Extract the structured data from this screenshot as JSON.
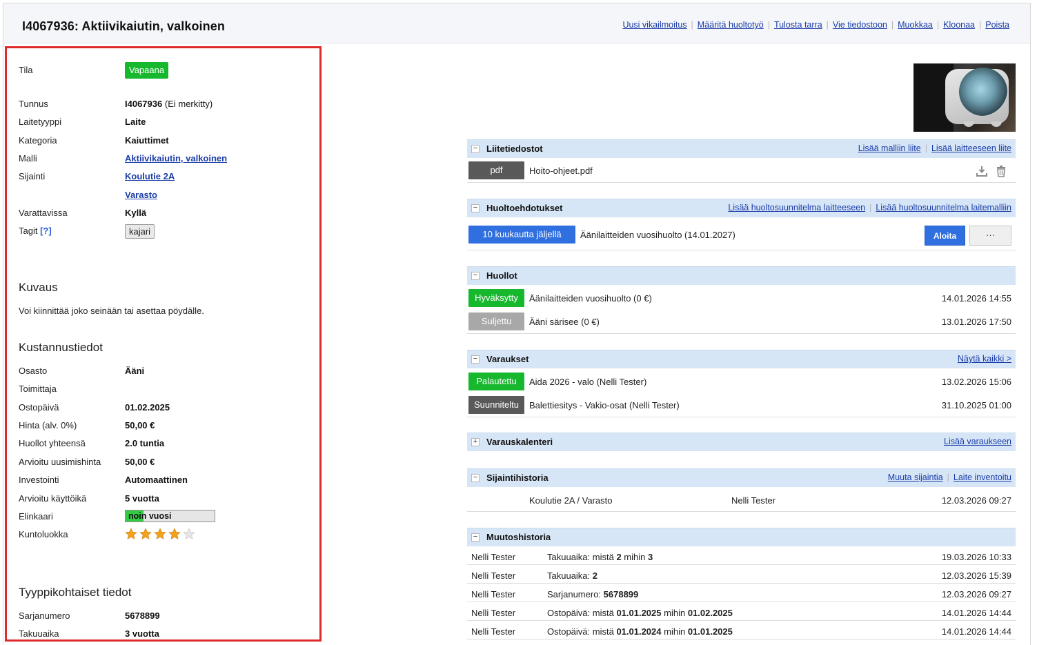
{
  "header": {
    "title": "I4067936: Aktiivikaiutin, valkoinen",
    "actions": [
      "Uusi vikailmoitus",
      "Määritä huoltotyö",
      "Tulosta tarra",
      "Vie tiedostoon",
      "Muokkaa",
      "Kloonaa",
      "Poista"
    ]
  },
  "details": {
    "tila_label": "Tila",
    "tila_value": "Vapaana",
    "tunnus_label": "Tunnus",
    "tunnus_value": "I4067936",
    "tunnus_note": "(Ei merkitty)",
    "laitetyyppi_label": "Laitetyyppi",
    "laitetyyppi_value": "Laite",
    "kategoria_label": "Kategoria",
    "kategoria_value": "Kaiuttimet",
    "malli_label": "Malli",
    "malli_value": "Aktiivikaiutin, valkoinen",
    "sijainti_label": "Sijainti",
    "sijainti_value1": "Koulutie 2A",
    "sijainti_value2": "Varasto",
    "varattavissa_label": "Varattavissa",
    "varattavissa_value": "Kyllä",
    "tagit_label": "Tagit",
    "tagit_help": "[?]",
    "tag": "kajari"
  },
  "kuvaus": {
    "heading": "Kuvaus",
    "text": "Voi kiinnittää joko seinään tai asettaa pöydälle."
  },
  "kustannus": {
    "heading": "Kustannustiedot",
    "rows": [
      {
        "label": "Osasto",
        "value": "Ääni"
      },
      {
        "label": "Toimittaja",
        "value": ""
      },
      {
        "label": "Ostopäivä",
        "value": "01.02.2025"
      },
      {
        "label": "Hinta (alv. 0%)",
        "value": "50,00 €"
      },
      {
        "label": "Huollot yhteensä",
        "value": "2.0 tuntia"
      },
      {
        "label": "Arvioitu uusimishinta",
        "value": "50,00 €"
      },
      {
        "label": "Investointi",
        "value": "Automaattinen"
      },
      {
        "label": "Arvioitu käyttöikä",
        "value": "5 vuotta"
      }
    ],
    "elinkaari_label": "Elinkaari",
    "elinkaari_value": "noin vuosi",
    "elinkaari_fraction": 0.2,
    "kuntoluokka_label": "Kuntoluokka",
    "kuntoluokka_rating": 4,
    "kuntoluokka_max": 5
  },
  "tyyppi": {
    "heading": "Tyyppikohtaiset tiedot",
    "rows": [
      {
        "label": "Sarjanumero",
        "value": "5678899"
      },
      {
        "label": "Takuuaika",
        "value": "3 vuotta"
      }
    ]
  },
  "liitetiedostot": {
    "title": "Liitetiedostot",
    "links": [
      "Lisää malliin liite",
      "Lisää laitteeseen liite"
    ],
    "file_type": "pdf",
    "file_name": "Hoito-ohjeet.pdf"
  },
  "huoltoehdotukset": {
    "title": "Huoltoehdotukset",
    "links": [
      "Lisää huoltosuunnitelma laitteeseen",
      "Lisää huoltosuunnitelma laitemalliin"
    ],
    "status": "10 kuukautta jäljellä",
    "name": "Äänilaitteiden vuosihuolto (14.01.2027)",
    "start_button": "Aloita",
    "more_button": "···"
  },
  "huollot": {
    "title": "Huollot",
    "rows": [
      {
        "status": "Hyväksytty",
        "name": "Äänilaitteiden vuosihuolto (0 €)",
        "date": "14.01.2026 14:55"
      },
      {
        "status": "Suljettu",
        "name": "Ääni särisee (0 €)",
        "date": "13.01.2026 17:50"
      }
    ]
  },
  "varaukset": {
    "title": "Varaukset",
    "link": "Näytä kaikki >",
    "rows": [
      {
        "status": "Palautettu",
        "name": "Aida 2026 - valo (Nelli Tester)",
        "date": "13.02.2026 15:06"
      },
      {
        "status": "Suunniteltu",
        "name": "Balettiesitys - Vakio-osat (Nelli Tester)",
        "date": "31.10.2025 01:00"
      }
    ]
  },
  "varauskalenteri": {
    "title": "Varauskalenteri",
    "link": "Lisää varaukseen"
  },
  "sijaintihistoria": {
    "title": "Sijaintihistoria",
    "links": [
      "Muuta sijaintia",
      "Laite inventoitu"
    ],
    "row": {
      "place": "Koulutie 2A / Varasto",
      "user": "Nelli Tester",
      "date": "12.03.2026 09:27"
    }
  },
  "muutoshistoria": {
    "title": "Muutoshistoria",
    "rows": [
      {
        "user": "Nelli Tester",
        "prefix": "Takuuaika: mistä ",
        "b1": "2",
        "mid": " mihin ",
        "b2": "3",
        "date": "19.03.2026 10:33"
      },
      {
        "user": "Nelli Tester",
        "prefix": "Takuuaika: ",
        "b1": "2",
        "mid": "",
        "b2": "",
        "date": "12.03.2026 15:39"
      },
      {
        "user": "Nelli Tester",
        "prefix": "Sarjanumero: ",
        "b1": "5678899",
        "mid": "",
        "b2": "",
        "date": "12.03.2026 09:27"
      },
      {
        "user": "Nelli Tester",
        "prefix": "Ostopäivä: mistä ",
        "b1": "01.01.2025",
        "mid": " mihin ",
        "b2": "01.02.2025",
        "date": "14.01.2026 14:44"
      },
      {
        "user": "Nelli Tester",
        "prefix": "Ostopäivä: mistä ",
        "b1": "01.01.2024",
        "mid": " mihin ",
        "b2": "01.01.2025",
        "date": "14.01.2026 14:44"
      }
    ]
  },
  "colors": {
    "green": "#17b82e",
    "blue": "#2f6fe0",
    "panel_header": "#d7e6f6",
    "highlight_border": "#e02a2a"
  }
}
